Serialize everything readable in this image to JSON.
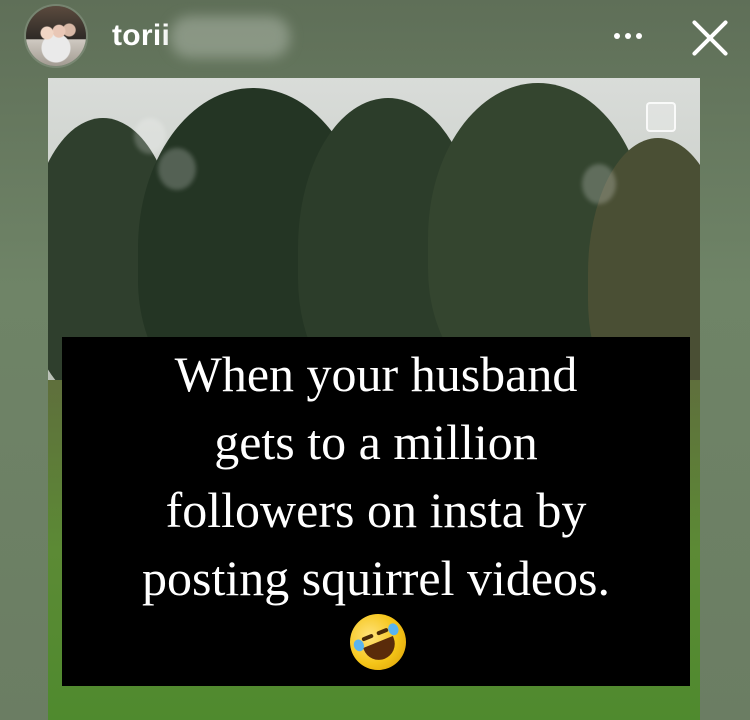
{
  "header": {
    "username": "torii",
    "more_icon": "more-horizontal-icon",
    "close_icon": "close-icon"
  },
  "story": {
    "caption_lines": [
      "When your husband",
      "gets to a million",
      "followers on insta by",
      "posting squirrel videos."
    ],
    "emoji": "rolling-on-the-floor-laughing-emoji"
  },
  "colors": {
    "background": "#6b7d63",
    "caption_bg": "#000000",
    "caption_text": "#ffffff"
  }
}
